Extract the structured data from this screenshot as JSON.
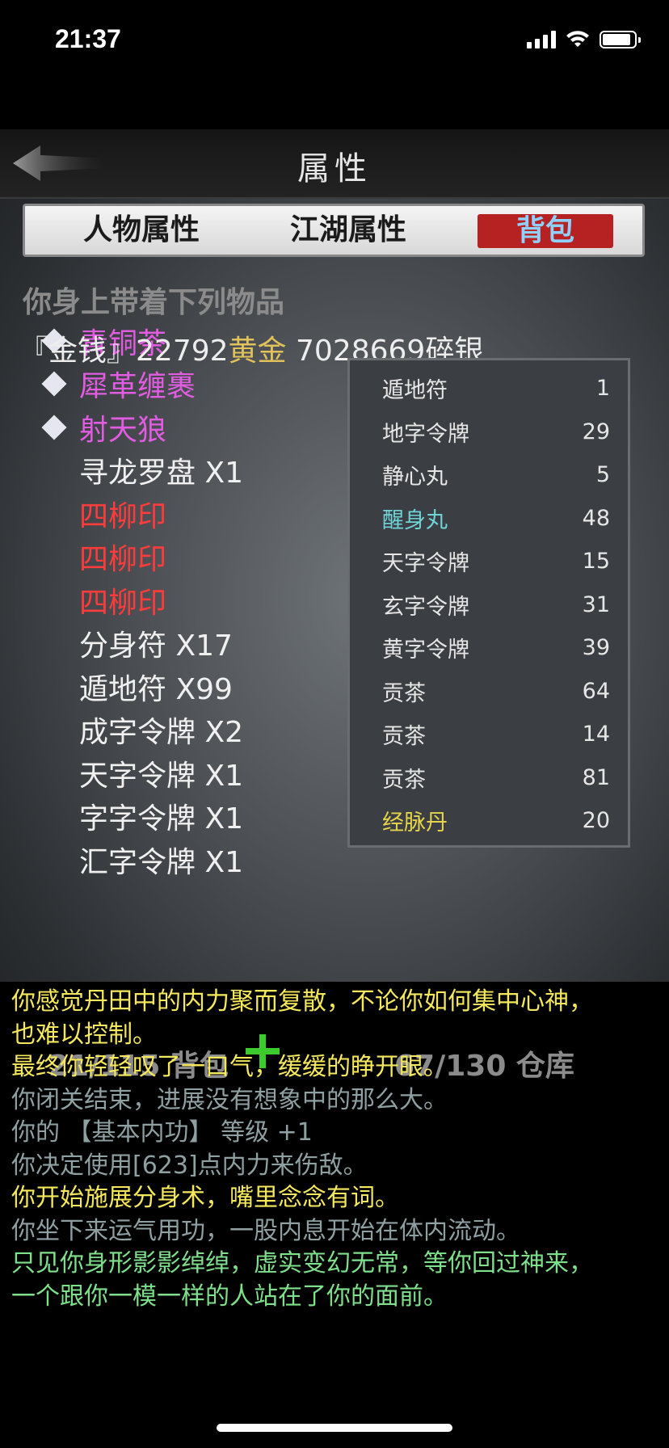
{
  "status": {
    "time": "21:37"
  },
  "header": {
    "title": "属性"
  },
  "tabs": [
    {
      "label": "人物属性"
    },
    {
      "label": "江湖属性"
    },
    {
      "label": "背包"
    }
  ],
  "bag": {
    "carry_text": "你身上带着下列物品",
    "money": {
      "prefix": "『金钱』",
      "gold_amount": "22792",
      "gold_label": "黄金",
      "silver": " 7028669碎银"
    },
    "items": [
      {
        "label": "青铜茶",
        "color": "purple",
        "diamond": true
      },
      {
        "label": "犀革缠裹",
        "color": "purple",
        "diamond": true
      },
      {
        "label": "射天狼",
        "color": "purple",
        "diamond": true
      },
      {
        "label": "寻龙罗盘 X1",
        "color": "white",
        "diamond": false
      },
      {
        "label": "四柳印",
        "color": "red",
        "diamond": false
      },
      {
        "label": "四柳印",
        "color": "red",
        "diamond": false
      },
      {
        "label": "四柳印",
        "color": "red",
        "diamond": false
      },
      {
        "label": "分身符 X17",
        "color": "white",
        "diamond": false
      },
      {
        "label": "遁地符 X99",
        "color": "white",
        "diamond": false
      },
      {
        "label": "成字令牌 X2",
        "color": "white",
        "diamond": false
      },
      {
        "label": "天字令牌 X1",
        "color": "white",
        "diamond": false
      },
      {
        "label": "字字令牌 X1",
        "color": "white",
        "diamond": false
      },
      {
        "label": "汇字令牌 X1",
        "color": "white",
        "diamond": false
      }
    ],
    "bag_footer": "21/115 背包",
    "store_footer": "67/130 仓库"
  },
  "warehouse": [
    {
      "name": "遁地符",
      "count": "1",
      "color": "white"
    },
    {
      "name": "地字令牌",
      "count": "29",
      "color": "white"
    },
    {
      "name": "静心丸",
      "count": "5",
      "color": "white"
    },
    {
      "name": "醒身丸",
      "count": "48",
      "color": "teal"
    },
    {
      "name": "天字令牌",
      "count": "15",
      "color": "white"
    },
    {
      "name": "玄字令牌",
      "count": "31",
      "color": "white"
    },
    {
      "name": "黄字令牌",
      "count": "39",
      "color": "white"
    },
    {
      "name": "贡茶",
      "count": "64",
      "color": "white"
    },
    {
      "name": "贡茶",
      "count": "14",
      "color": "white"
    },
    {
      "name": "贡茶",
      "count": "81",
      "color": "white"
    },
    {
      "name": "经脉丹",
      "count": "20",
      "color": "yellow"
    }
  ],
  "log": [
    {
      "text": "你感觉丹田中的内力聚而复散，不论你如何集中心神，",
      "color": "yellow"
    },
    {
      "text": "也难以控制。",
      "color": "yellow"
    },
    {
      "text": "最终你轻轻叹了一口气，缓缓的睁开眼。",
      "color": "yellow"
    },
    {
      "text": "你闭关结束，进展没有想象中的那么大。",
      "color": "gray"
    },
    {
      "text": "你的 【基本内功】 等级 +1",
      "color": "gray"
    },
    {
      "text": "你决定使用[623]点内力来伤敌。",
      "color": "gray"
    },
    {
      "text": "你开始施展分身术，嘴里念念有词。",
      "color": "yellow"
    },
    {
      "text": "你坐下来运气用功，一股内息开始在体内流动。",
      "color": "gray"
    },
    {
      "text": "只见你身形影影绰绰，虚实变幻无常，等你回过神来，",
      "color": "green"
    },
    {
      "text": "一个跟你一模一样的人站在了你的面前。",
      "color": "green"
    }
  ]
}
